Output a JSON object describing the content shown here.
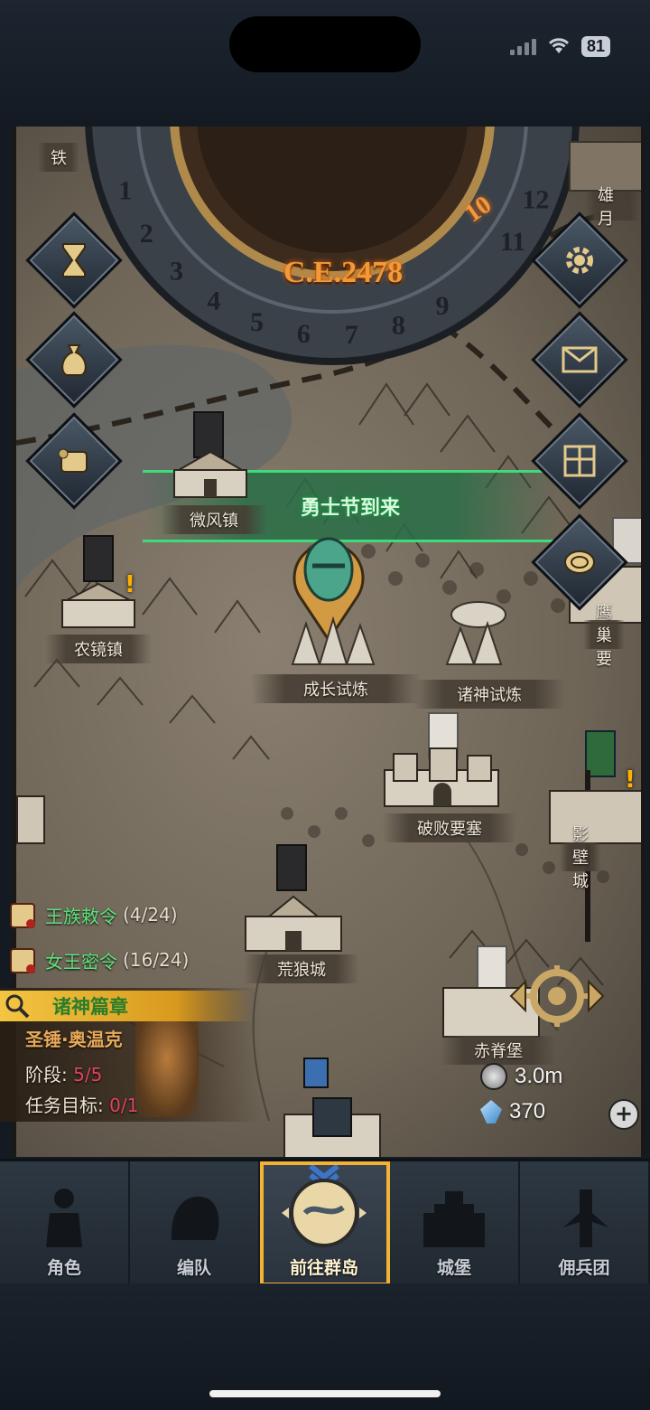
{
  "status_bar": {
    "battery": "81"
  },
  "header": {
    "year": "C.E.2478",
    "current_month": "10",
    "months": [
      "1",
      "2",
      "3",
      "4",
      "5",
      "6",
      "7",
      "8",
      "9",
      "10",
      "11",
      "12"
    ]
  },
  "event_banner": {
    "text": "勇士节到来"
  },
  "side_buttons": {
    "left": [
      {
        "name": "hourglass-icon"
      },
      {
        "name": "money-bag-icon"
      },
      {
        "name": "scroll-icon"
      }
    ],
    "right": [
      {
        "name": "gear-icon"
      },
      {
        "name": "mail-icon"
      },
      {
        "name": "window-icon"
      },
      {
        "name": "coin-icon"
      }
    ]
  },
  "locations": {
    "tie": "铁",
    "xiongyue": "雄月",
    "weifeng": "微风镇",
    "nongjing": "农镜镇",
    "yingchao": "鹰巢要",
    "chengzhang": "成长试炼",
    "zhushen": "诸神试炼",
    "pobai": "破败要塞",
    "yingbi": "影壁城",
    "huanglang": "荒狼城",
    "chiji": "赤脊堡"
  },
  "quests": [
    {
      "name": "王族敕令",
      "count": "(4/24)"
    },
    {
      "name": "女王密令",
      "count": "(16/24)"
    }
  ],
  "chapter": {
    "title": "诸神篇章",
    "hero": "圣锤·奥温克",
    "stage_label": "阶段:",
    "stage_value": "5/5",
    "target_label": "任务目标:",
    "target_value": "0/1"
  },
  "resources": {
    "silver": "3.0m",
    "crystal": "370"
  },
  "tabs": [
    {
      "label": "角色",
      "active": false
    },
    {
      "label": "编队",
      "active": false
    },
    {
      "label": "前往群岛",
      "active": true
    },
    {
      "label": "城堡",
      "active": false
    },
    {
      "label": "佣兵团",
      "active": false
    }
  ],
  "colors": {
    "accent_gold": "#f2b335",
    "quest_green": "#5fe07a",
    "banner_green": "#3ddb7a",
    "year_orange": "#f19a3a"
  }
}
